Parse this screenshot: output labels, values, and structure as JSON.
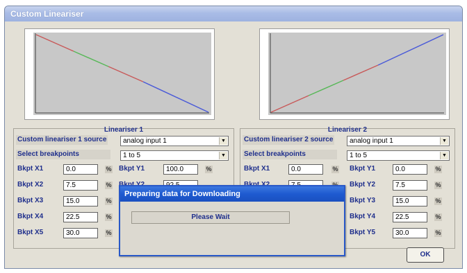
{
  "window": {
    "title": "Custom Lineariser"
  },
  "lineariser1": {
    "group_title": "Lineariser 1",
    "source_label": "Custom lineariser 1 source",
    "source_value": "analog input 1",
    "breakpoints_label": "Select breakpoints",
    "breakpoints_value": "1 to 5",
    "x": [
      {
        "label": "Bkpt X1",
        "value": "0.0",
        "unit": "%"
      },
      {
        "label": "Bkpt X2",
        "value": "7.5",
        "unit": "%"
      },
      {
        "label": "Bkpt X3",
        "value": "15.0",
        "unit": "%"
      },
      {
        "label": "Bkpt X4",
        "value": "22.5",
        "unit": "%"
      },
      {
        "label": "Bkpt X5",
        "value": "30.0",
        "unit": "%"
      }
    ],
    "y": [
      {
        "label": "Bkpt Y1",
        "value": "100.0",
        "unit": "%"
      },
      {
        "label": "Bkpt Y2",
        "value": "92.5",
        "unit": "%"
      }
    ],
    "curve": "descending"
  },
  "lineariser2": {
    "group_title": "Lineariser 2",
    "source_label": "Custom lineariser 2 source",
    "source_value": "analog input 1",
    "breakpoints_label": "Select breakpoints",
    "breakpoints_value": "1 to 5",
    "x": [
      {
        "label": "Bkpt X1",
        "value": "0.0",
        "unit": "%"
      },
      {
        "label": "Bkpt X2",
        "value": "7.5",
        "unit": "%"
      }
    ],
    "y": [
      {
        "label": "Bkpt Y1",
        "value": "0.0",
        "unit": "%"
      },
      {
        "label": "Bkpt Y2",
        "value": "7.5",
        "unit": "%"
      },
      {
        "label": "Bkpt Y3",
        "value": "15.0",
        "unit": "%"
      },
      {
        "label": "Bkpt Y4",
        "value": "22.5",
        "unit": "%"
      },
      {
        "label": "Bkpt Y5",
        "value": "30.0",
        "unit": "%"
      }
    ],
    "curve": "ascending"
  },
  "dialog": {
    "title": "Preparing data for Downloading",
    "message": "Please Wait"
  },
  "ok_label": "OK",
  "colors": {
    "titlebar": "#a9bce6",
    "dialog_titlebar": "#1e5ad0",
    "label_text": "#1f2f8c",
    "plot_bg": "#c8c8c8",
    "curve": "#4a5ad8",
    "curve_accent_green": "#58b858",
    "curve_accent_red": "#c85a5a"
  },
  "icons": [
    "dropdown-arrow-icon",
    "percent-unit-icon"
  ]
}
